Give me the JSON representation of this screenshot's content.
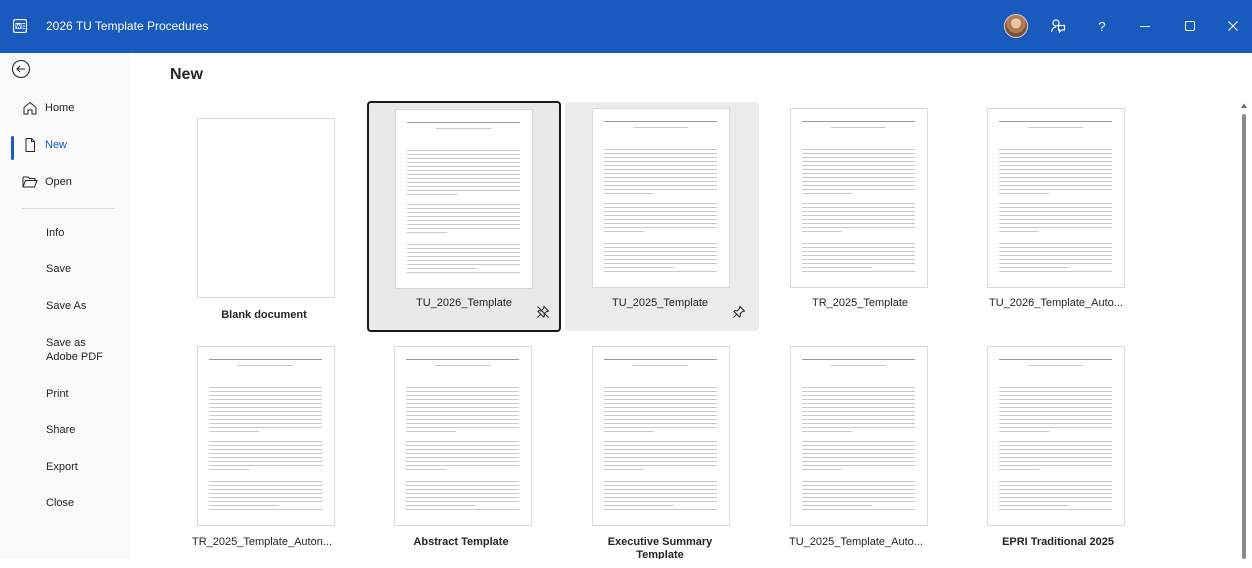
{
  "titlebar": {
    "doc_title": "2026 TU Template Procedures",
    "bg_color": "#185abd"
  },
  "sidebar": {
    "back_icon": "back-arrow-icon",
    "items": [
      {
        "label": "Home",
        "icon": "home-icon"
      },
      {
        "label": "New",
        "icon": "new-document-icon",
        "active": true
      },
      {
        "label": "Open",
        "icon": "open-folder-icon"
      }
    ],
    "sub_items": [
      {
        "label": "Info"
      },
      {
        "label": "Save"
      },
      {
        "label": "Save As"
      },
      {
        "label": "Save as",
        "label2": "Adobe PDF"
      },
      {
        "label": "Print"
      },
      {
        "label": "Share"
      },
      {
        "label": "Export"
      },
      {
        "label": "Close"
      }
    ]
  },
  "main": {
    "title": "New",
    "templates": [
      {
        "label": "Blank document"
      },
      {
        "label": "TU_2026_Template"
      },
      {
        "label": "TU_2025_Template"
      },
      {
        "label": "TR_2025_Template"
      },
      {
        "label": "TU_2026_Template_Auto..."
      },
      {
        "label": "TR_2025_Template_Auton..."
      },
      {
        "label": "Abstract Template"
      },
      {
        "label": "Executive Summary",
        "label2": "Template"
      },
      {
        "label": "TU_2025_Template_Auto..."
      },
      {
        "label": "EPRI Traditional 2025"
      }
    ]
  },
  "colors": {
    "accent": "#185abd",
    "selected_border": "#1a1a1a"
  }
}
